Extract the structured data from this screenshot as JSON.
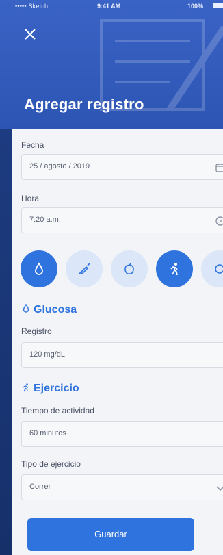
{
  "status": {
    "carrier": "••••• Sketch",
    "time": "9:41 AM",
    "battery": "100%"
  },
  "header": {
    "title": "Agregar registro"
  },
  "form": {
    "fecha": {
      "label": "Fecha",
      "value": "25 / agosto / 2019"
    },
    "hora": {
      "label": "Hora",
      "value": "7:20 a.m."
    },
    "categories": [
      {
        "name": "glucose",
        "icon": "drop-icon",
        "active": true
      },
      {
        "name": "insulin",
        "icon": "syringe-icon",
        "active": false
      },
      {
        "name": "food",
        "icon": "apple-icon",
        "active": false
      },
      {
        "name": "exercise",
        "icon": "running-icon",
        "active": true
      },
      {
        "name": "more",
        "icon": "circle-icon",
        "active": false
      }
    ],
    "glucosa": {
      "title": "Glucosa",
      "registro_label": "Registro",
      "registro_value": "120 mg/dL"
    },
    "ejercicio": {
      "title": "Ejercicio",
      "tiempo_label": "Tiempo de actividad",
      "tiempo_value": "60 minutos",
      "tipo_label": "Tipo de ejercicio",
      "tipo_value": "Correr"
    }
  },
  "actions": {
    "save_label": "Guardar"
  },
  "colors": {
    "accent": "#2f73de",
    "header_bg": "#2d55b3",
    "card_bg": "#f2f4f7"
  }
}
